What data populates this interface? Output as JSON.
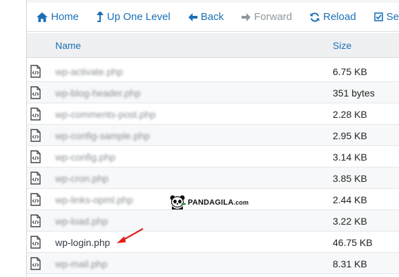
{
  "toolbar": {
    "home_label": "Home",
    "up_label": "Up One Level",
    "back_label": "Back",
    "forward_label": "Forward",
    "reload_label": "Reload",
    "select_label": "Select"
  },
  "table": {
    "col_name": "Name",
    "col_size": "Size",
    "rows": [
      {
        "name": "wp-activate.php",
        "size": "6.75 KB",
        "blurred": true
      },
      {
        "name": "wp-blog-header.php",
        "size": "351 bytes",
        "blurred": true
      },
      {
        "name": "wp-comments-post.php",
        "size": "2.28 KB",
        "blurred": true
      },
      {
        "name": "wp-config-sample.php",
        "size": "2.95 KB",
        "blurred": true
      },
      {
        "name": "wp-config.php",
        "size": "3.14 KB",
        "blurred": true
      },
      {
        "name": "wp-cron.php",
        "size": "3.85 KB",
        "blurred": true
      },
      {
        "name": "wp-links-opml.php",
        "size": "2.44 KB",
        "blurred": true
      },
      {
        "name": "wp-load.php",
        "size": "3.22 KB",
        "blurred": true
      },
      {
        "name": "wp-login.php",
        "size": "46.75 KB",
        "blurred": false
      },
      {
        "name": "wp-mail.php",
        "size": "8.31 KB",
        "blurred": true
      }
    ]
  },
  "watermark": {
    "brand": "PANDAGILA",
    "domain": ".com"
  },
  "colors": {
    "link": "#1a6fb5",
    "disabled": "#8e969c",
    "arrow": "#e0201b"
  },
  "icons": {
    "home": "home-icon",
    "up": "level-up-icon",
    "back": "arrow-left-icon",
    "forward": "arrow-right-icon",
    "reload": "reload-icon",
    "select": "checkbox-icon",
    "file": "code-file-icon"
  }
}
